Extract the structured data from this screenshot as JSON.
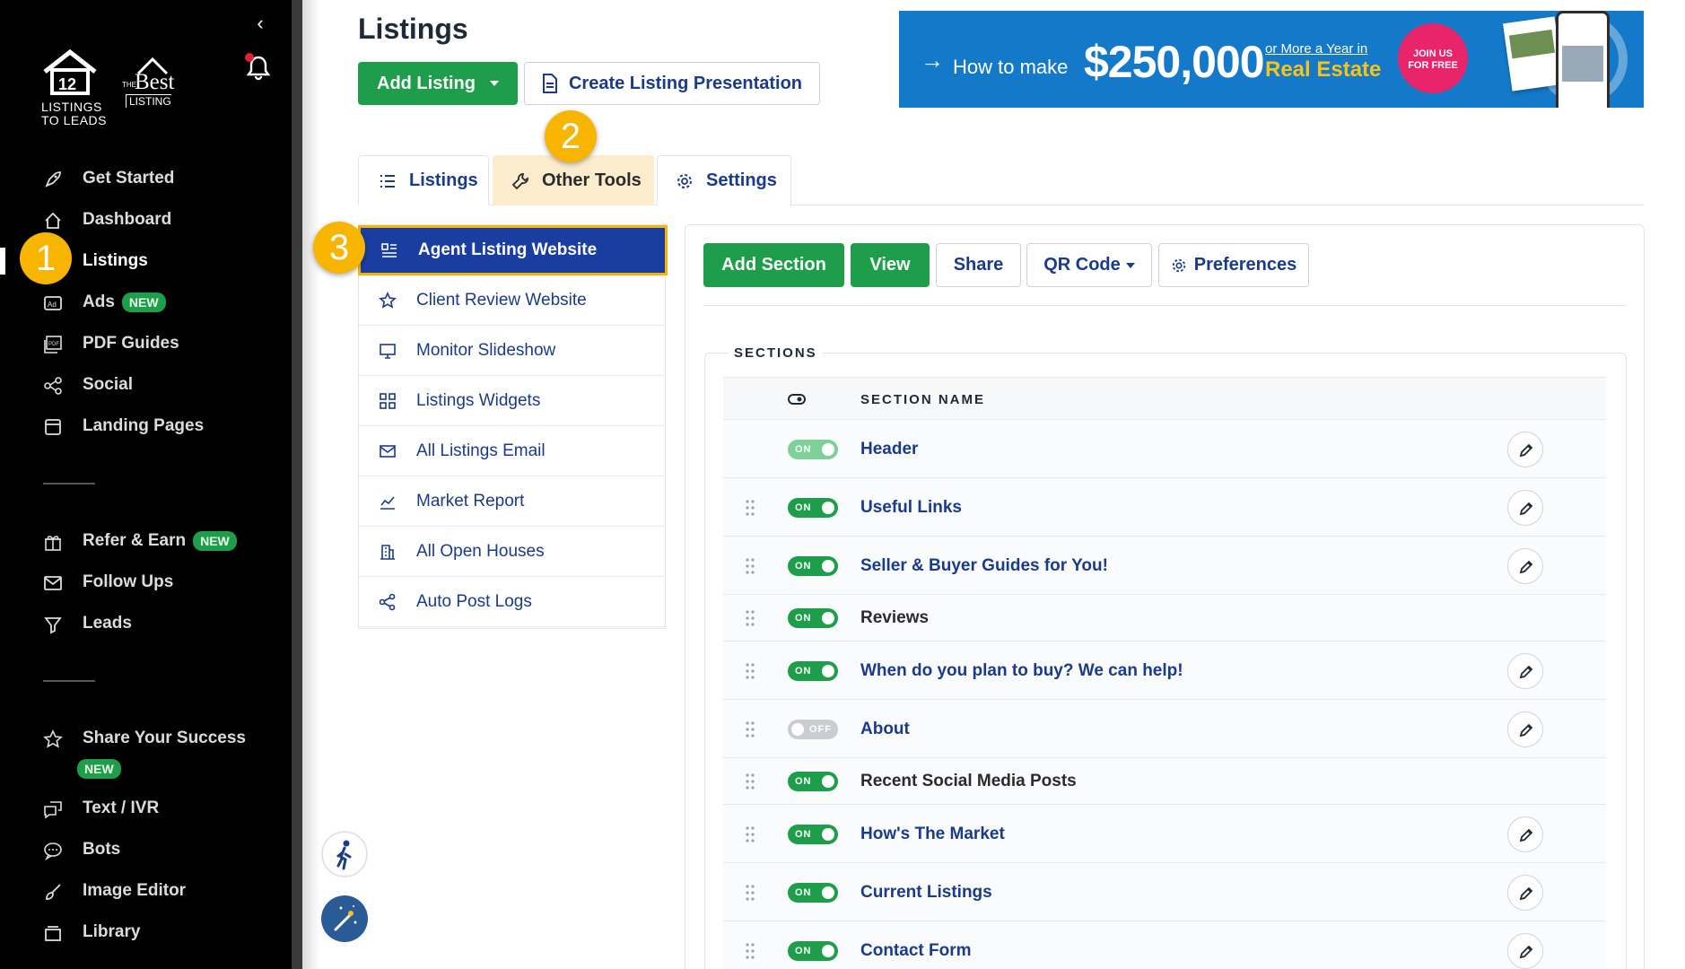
{
  "sidebar": {
    "logo1_text": "LISTINGS\nTO LEADS",
    "logo1_num": "12",
    "logo2_the": "THE",
    "logo2_best": "Best",
    "logo2_listing": "LISTING",
    "items": [
      {
        "label": "Get Started",
        "icon": "rocket-icon"
      },
      {
        "label": "Dashboard",
        "icon": "home-icon"
      },
      {
        "label": "Listings",
        "icon": "listings-icon"
      },
      {
        "label": "Ads",
        "icon": "ad-icon",
        "badge": "NEW"
      },
      {
        "label": "PDF Guides",
        "icon": "pdf-icon"
      },
      {
        "label": "Social",
        "icon": "share-icon"
      },
      {
        "label": "Landing Pages",
        "icon": "page-icon"
      },
      {
        "label": "Refer & Earn",
        "icon": "gift-icon",
        "badge": "NEW"
      },
      {
        "label": "Follow Ups",
        "icon": "mail-icon"
      },
      {
        "label": "Leads",
        "icon": "filter-icon"
      },
      {
        "label": "Share Your Success",
        "icon": "star-icon",
        "badge": "NEW"
      },
      {
        "label": "Text / IVR",
        "icon": "chat-icon"
      },
      {
        "label": "Bots",
        "icon": "bot-icon"
      },
      {
        "label": "Image Editor",
        "icon": "brush-icon"
      },
      {
        "label": "Library",
        "icon": "library-icon"
      }
    ]
  },
  "callouts": [
    "1",
    "2",
    "3"
  ],
  "header": {
    "title": "Listings",
    "add_listing": "Add Listing",
    "create_presentation": "Create Listing Presentation"
  },
  "banner": {
    "how_to": "How to make",
    "amount": "$250,000",
    "or_more": "or More a Year in",
    "real_estate": "Real Estate",
    "join": "JOIN US",
    "free": "FOR FREE"
  },
  "tabs": [
    {
      "label": "Listings",
      "icon": "list-icon"
    },
    {
      "label": "Other Tools",
      "icon": "wrench-icon",
      "active": true
    },
    {
      "label": "Settings",
      "icon": "gear-icon"
    }
  ],
  "tools": [
    {
      "label": "Agent Listing Website",
      "icon": "website-icon",
      "active": true
    },
    {
      "label": "Client Review Website",
      "icon": "star-icon"
    },
    {
      "label": "Monitor Slideshow",
      "icon": "monitor-icon"
    },
    {
      "label": "Listings Widgets",
      "icon": "widgets-icon"
    },
    {
      "label": "All Listings Email",
      "icon": "mail-icon"
    },
    {
      "label": "Market Report",
      "icon": "chart-icon"
    },
    {
      "label": "All Open Houses",
      "icon": "building-icon"
    },
    {
      "label": "Auto Post Logs",
      "icon": "share-icon"
    }
  ],
  "toolbar": {
    "add_section": "Add Section",
    "view": "View",
    "share": "Share",
    "qr_code": "QR Code",
    "preferences": "Preferences"
  },
  "sections": {
    "legend": "SECTIONS",
    "col_name": "SECTION NAME",
    "rows": [
      {
        "name": "Header",
        "state": "ON",
        "on": true,
        "dim": true,
        "draggable": false,
        "editable": true,
        "link": true
      },
      {
        "name": "Useful Links",
        "state": "ON",
        "on": true,
        "draggable": true,
        "editable": true,
        "link": true
      },
      {
        "name": "Seller & Buyer Guides for You!",
        "state": "ON",
        "on": true,
        "draggable": true,
        "editable": true,
        "link": true
      },
      {
        "name": "Reviews",
        "state": "ON",
        "on": true,
        "draggable": true,
        "editable": false,
        "link": false
      },
      {
        "name": "When do you plan to buy? We can help!",
        "state": "ON",
        "on": true,
        "draggable": true,
        "editable": true,
        "link": true
      },
      {
        "name": "About",
        "state": "OFF",
        "on": false,
        "draggable": true,
        "editable": true,
        "link": true
      },
      {
        "name": "Recent Social Media Posts",
        "state": "ON",
        "on": true,
        "draggable": true,
        "editable": false,
        "link": false
      },
      {
        "name": "How's The Market",
        "state": "ON",
        "on": true,
        "draggable": true,
        "editable": true,
        "link": true
      },
      {
        "name": "Current Listings",
        "state": "ON",
        "on": true,
        "draggable": true,
        "editable": true,
        "link": true
      },
      {
        "name": "Contact Form",
        "state": "ON",
        "on": true,
        "draggable": true,
        "editable": true,
        "link": true
      }
    ]
  },
  "colors": {
    "green": "#1e9e4a",
    "navy": "#1a3a8a",
    "callout": "#f7b500",
    "active_tool": "#1a3ea0"
  }
}
